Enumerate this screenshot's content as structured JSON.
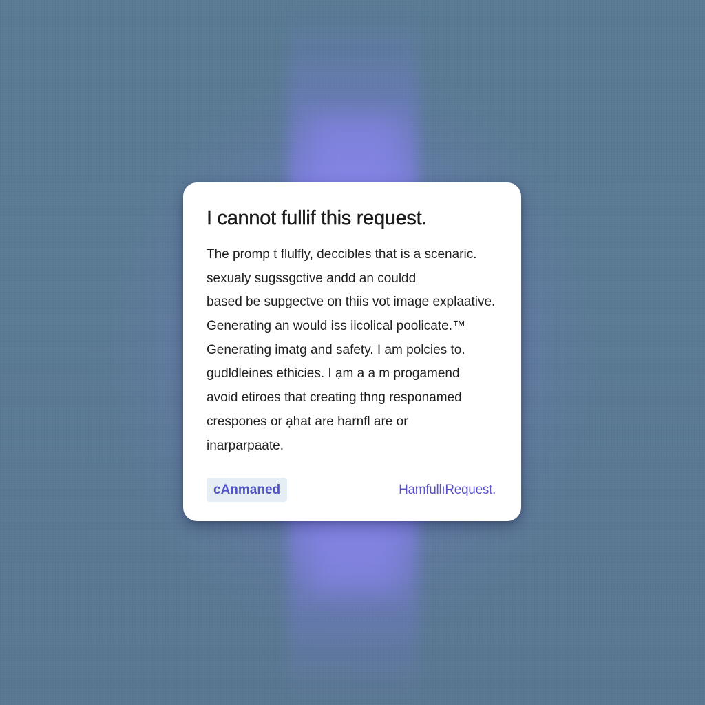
{
  "background": {
    "base_color": "#56778f",
    "glow_color": "#8a86ea"
  },
  "dialog": {
    "title": "I cannot fullif this request.",
    "lines": [
      "The promp t flulfly,  deccibles that is a scenaric.",
      "sexualy sugssgctive andd an couldd",
      "based be supgectve on thiis vot image explaative.",
      "Generating an would iss iicolical poolicate.™",
      "Generating imatg and safety. I am polcies to.",
      "gudldleines ethicies. I ạm a a m progamend",
      "avoid etiroes that  creating thng responamed",
      "crespones or ạhat are harnfl are or",
      "inarparpaate."
    ],
    "badge_label": "cAnmaned",
    "tag_label": "HamfullıRequest."
  }
}
